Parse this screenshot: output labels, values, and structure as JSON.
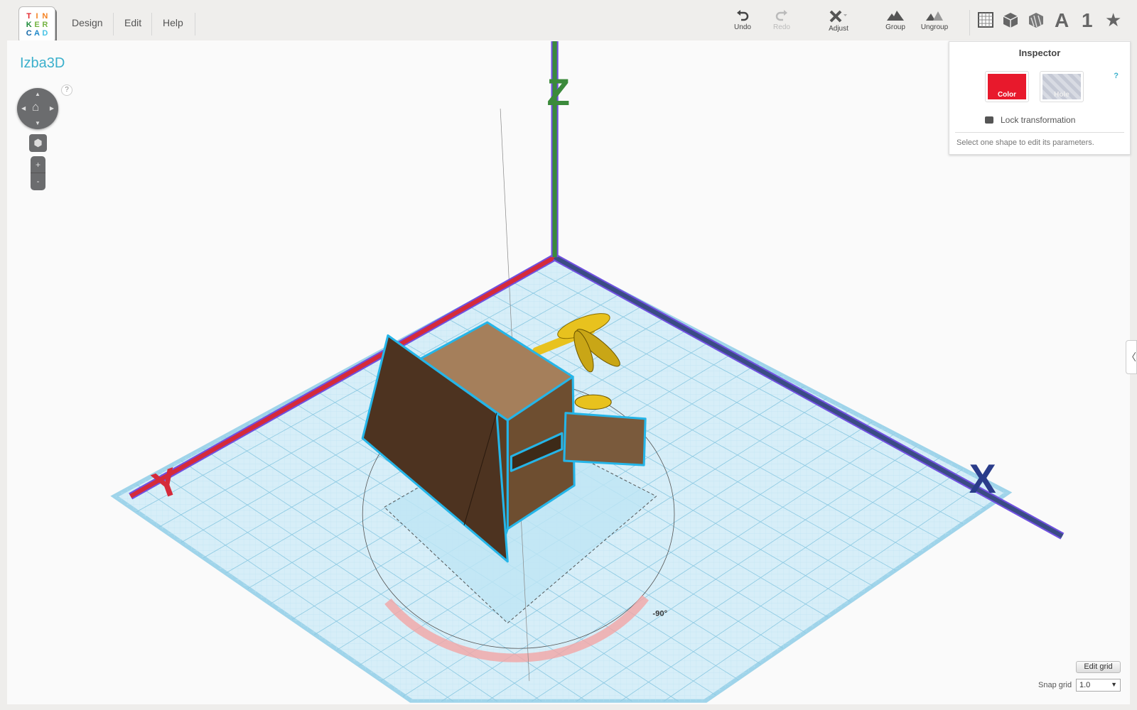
{
  "app": {
    "logo_letters": [
      "T",
      "I",
      "N",
      "K",
      "E",
      "R",
      "C",
      "A",
      "D"
    ],
    "logo_colors": [
      "#e3262c",
      "#f58220",
      "#f58220",
      "#1f8b3a",
      "#75b443",
      "#75b443",
      "#1268a8",
      "#1c87c9",
      "#47c3e5"
    ]
  },
  "menu": {
    "items": [
      "Design",
      "Edit",
      "Help"
    ]
  },
  "toolbar": {
    "undo": "Undo",
    "redo": "Redo",
    "adjust": "Adjust",
    "group": "Group",
    "ungroup": "Ungroup",
    "text_a": "A",
    "number_1": "1",
    "star": "★"
  },
  "project": {
    "title": "Izba3D"
  },
  "nav": {
    "help": "?",
    "zoom_in": "+",
    "zoom_out": "-"
  },
  "inspector": {
    "title": "Inspector",
    "color_label": "Color",
    "hole_label": "Hole",
    "help": "?",
    "lock_label": "Lock transformation",
    "message": "Select one shape to edit its parameters.",
    "color": "#e8192c"
  },
  "scene": {
    "axes": {
      "z": "Z",
      "x": "X",
      "y": "Y"
    },
    "rotation_label": "-90°"
  },
  "grid": {
    "edit_label": "Edit grid",
    "snap_label": "Snap grid",
    "snap_value": "1.0"
  },
  "panel": {
    "collapse": "〈"
  }
}
